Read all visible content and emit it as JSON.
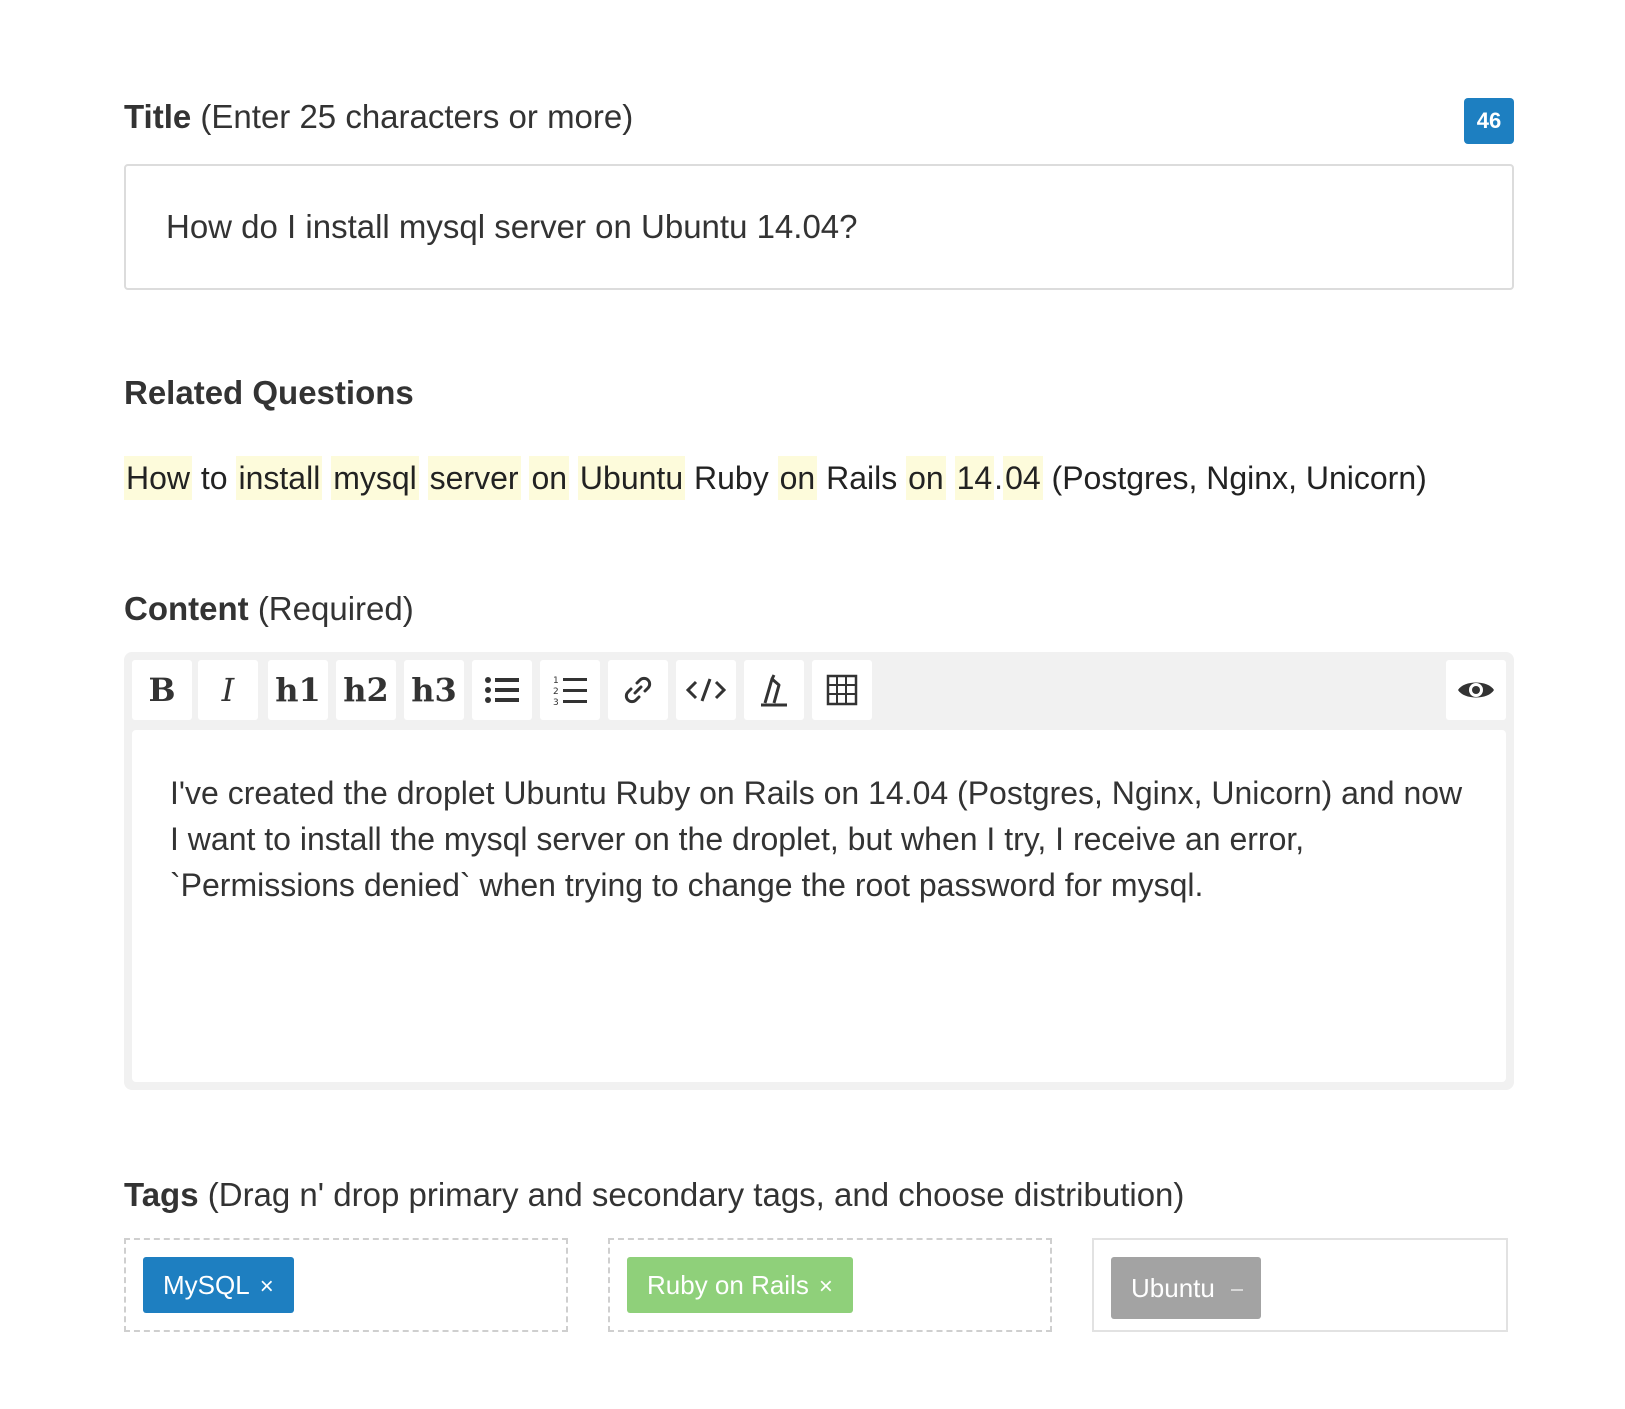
{
  "title": {
    "label": "Title",
    "hint": "(Enter 25 characters or more)",
    "count": "46",
    "value": "How do I install mysql server on Ubuntu 14.04?"
  },
  "related": {
    "heading": "Related Questions",
    "link_parts": [
      {
        "text": "How",
        "hl": true
      },
      {
        "text": " to ",
        "hl": false
      },
      {
        "text": "install",
        "hl": true
      },
      {
        "text": " ",
        "hl": false
      },
      {
        "text": "mysql",
        "hl": true
      },
      {
        "text": " ",
        "hl": false
      },
      {
        "text": "server",
        "hl": true
      },
      {
        "text": " ",
        "hl": false
      },
      {
        "text": "on",
        "hl": true
      },
      {
        "text": " ",
        "hl": false
      },
      {
        "text": "Ubuntu",
        "hl": true
      },
      {
        "text": " Ruby ",
        "hl": false
      },
      {
        "text": "on",
        "hl": true
      },
      {
        "text": " Rails ",
        "hl": false
      },
      {
        "text": "on",
        "hl": true
      },
      {
        "text": " ",
        "hl": false
      },
      {
        "text": "14",
        "hl": true
      },
      {
        "text": ".",
        "hl": false
      },
      {
        "text": "04",
        "hl": true
      },
      {
        "text": " (Postgres, Nginx, Unicorn)",
        "hl": false
      }
    ]
  },
  "content": {
    "label": "Content",
    "hint": "(Required)",
    "toolbar": {
      "bold": "B",
      "italic": "I",
      "h1": "h1",
      "h2": "h2",
      "h3": "h3"
    },
    "body": "I've created the droplet Ubuntu Ruby on Rails on 14.04 (Postgres, Nginx, Unicorn) and now I want to install the mysql server on the droplet, but when I try, I receive an error, `Permissions denied` when trying to change the root password for mysql."
  },
  "tags": {
    "label": "Tags",
    "hint": "(Drag n' drop primary and secondary tags, and choose distribution)",
    "primary": "MySQL",
    "secondary": "Ruby on Rails",
    "distribution": "Ubuntu",
    "remove_glyph": "×"
  },
  "colors": {
    "badge": "#1d7fc1",
    "tag_primary": "#1e7fc1",
    "tag_secondary": "#8fd07a",
    "tag_distribution": "#a3a3a3",
    "highlight": "#fdfbdb"
  }
}
